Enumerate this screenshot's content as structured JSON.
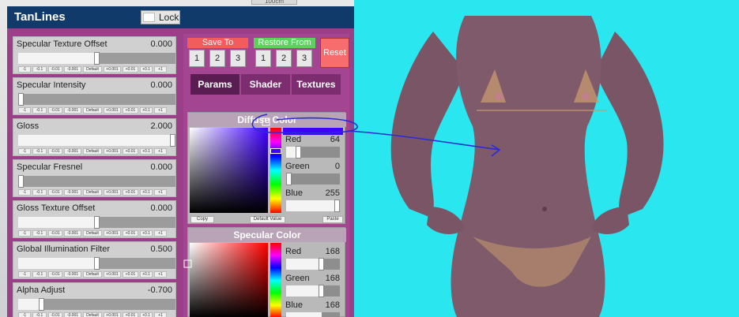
{
  "window": {
    "title": "TanLines",
    "lock_label": "Lock"
  },
  "top_chip_text": "100cm",
  "step_buttons": [
    "-1",
    "-0.1",
    "-0.01",
    "-0.001",
    "Default",
    "+0.001",
    "+0.01",
    "+0.1",
    "+1"
  ],
  "sliders": [
    {
      "label": "Specular Texture Offset",
      "value": "0.000",
      "fraction": 0.5
    },
    {
      "label": "Specular Intensity",
      "value": "0.000",
      "fraction": 0.0
    },
    {
      "label": "Gloss",
      "value": "2.000",
      "fraction": 1.0
    },
    {
      "label": "Specular Fresnel",
      "value": "0.000",
      "fraction": 0.0
    },
    {
      "label": "Gloss Texture Offset",
      "value": "0.000",
      "fraction": 0.5
    },
    {
      "label": "Global Illumination Filter",
      "value": "0.500",
      "fraction": 0.5
    },
    {
      "label": "Alpha Adjust",
      "value": "-0.700",
      "fraction": 0.15
    }
  ],
  "save_to": {
    "label": "Save To",
    "buttons": [
      "1",
      "2",
      "3"
    ],
    "color": "#f25c5c"
  },
  "restore_from": {
    "label": "Restore From",
    "buttons": [
      "1",
      "2",
      "3"
    ],
    "color": "#5cd15c"
  },
  "reset_label": "Reset",
  "tabs": [
    "Params",
    "Shader",
    "Textures"
  ],
  "active_tab": "Params",
  "diffuse_color": {
    "title": "Diffuse Color",
    "red": {
      "label": "Red",
      "value": "64",
      "fraction": 0.25
    },
    "green": {
      "label": "Green",
      "value": "0",
      "fraction": 0.0
    },
    "blue": {
      "label": "Blue",
      "value": "255",
      "fraction": 1.0
    },
    "buttons": [
      "Copy",
      "Default Value",
      "Paste"
    ],
    "color": "#4000ff"
  },
  "specular_color": {
    "title": "Specular Color",
    "red": {
      "label": "Red",
      "value": "168",
      "fraction": 0.66
    },
    "green": {
      "label": "Green",
      "value": "168",
      "fraction": 0.66
    },
    "blue": {
      "label": "Blue",
      "value": "168",
      "fraction": 0.66
    },
    "color": "#a8a8a8"
  },
  "colors": {
    "panel": "#9a3f88",
    "titlebar": "#0f3a6a",
    "background": "#29e6ef",
    "skin": "#7d5a6a",
    "tan": "#c99b6c",
    "annotation": "#2b2bd6"
  }
}
